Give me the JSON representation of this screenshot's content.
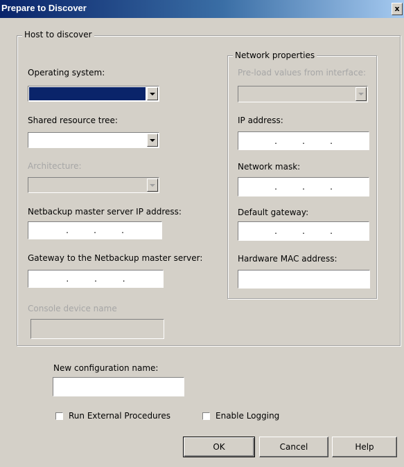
{
  "window": {
    "title": "Prepare to Discover",
    "close_label": "x"
  },
  "host_group": {
    "legend": "Host to discover",
    "os_label": "Operating system:",
    "shared_tree_label": "Shared resource tree:",
    "architecture_label": "Architecture:",
    "nbu_ip_label": "Netbackup master server IP address:",
    "nbu_gateway_label": "Gateway to the Netbackup master server:",
    "console_label": "Console device name"
  },
  "network_group": {
    "legend": "Network properties",
    "preload_label": "Pre-load values from interface:",
    "ip_label": "IP address:",
    "mask_label": "Network mask:",
    "gateway_label": "Default gateway:",
    "mac_label": "Hardware MAC address:"
  },
  "ip_dot": ".",
  "config": {
    "label": "New configuration name:"
  },
  "options": {
    "run_external": "Run External Procedures",
    "enable_logging": "Enable Logging"
  },
  "buttons": {
    "ok": "OK",
    "cancel": "Cancel",
    "help": "Help"
  }
}
